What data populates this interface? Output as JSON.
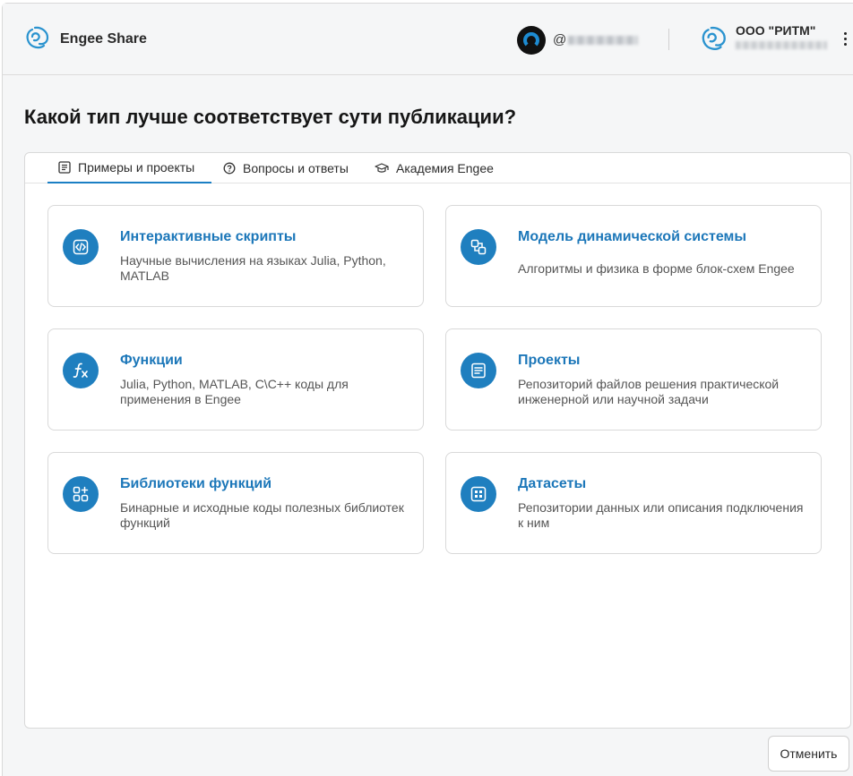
{
  "header": {
    "app_title": "Engee Share",
    "username": "@",
    "org_name": "ООО \"РИТМ\""
  },
  "page_title": "Какой тип лучше соответствует сути публикации?",
  "tabs": [
    {
      "label": "Примеры и проекты",
      "icon": "document-icon",
      "active": true
    },
    {
      "label": "Вопросы и ответы",
      "icon": "question-icon",
      "active": false
    },
    {
      "label": "Академия Engee",
      "icon": "graduation-cap-icon",
      "active": false
    }
  ],
  "cards": [
    {
      "title": "Интерактивные скрипты",
      "description": "Научные вычисления на языках Julia, Python, MATLAB",
      "icon": "code-icon"
    },
    {
      "title": "Модель динамической системы",
      "description": "Алгоритмы и физика в форме блок-схем Engee",
      "icon": "blocks-icon"
    },
    {
      "title": "Функции",
      "description": "Julia, Python, MATLAB, C\\C++ коды для применения в Engee",
      "icon": "function-icon"
    },
    {
      "title": "Проекты",
      "description": "Репозиторий файлов решения практической инженерной или научной задачи",
      "icon": "project-icon"
    },
    {
      "title": "Библиотеки функций",
      "description": "Бинарные и исходные коды полезных библиотек функций",
      "icon": "library-icon"
    },
    {
      "title": "Датасеты",
      "description": "Репозитории данных или описания подключения к ним",
      "icon": "dataset-icon"
    }
  ],
  "footer": {
    "cancel_label": "Отменить"
  },
  "colors": {
    "accent": "#1f7fbf",
    "title_blue": "#1c77b9"
  }
}
